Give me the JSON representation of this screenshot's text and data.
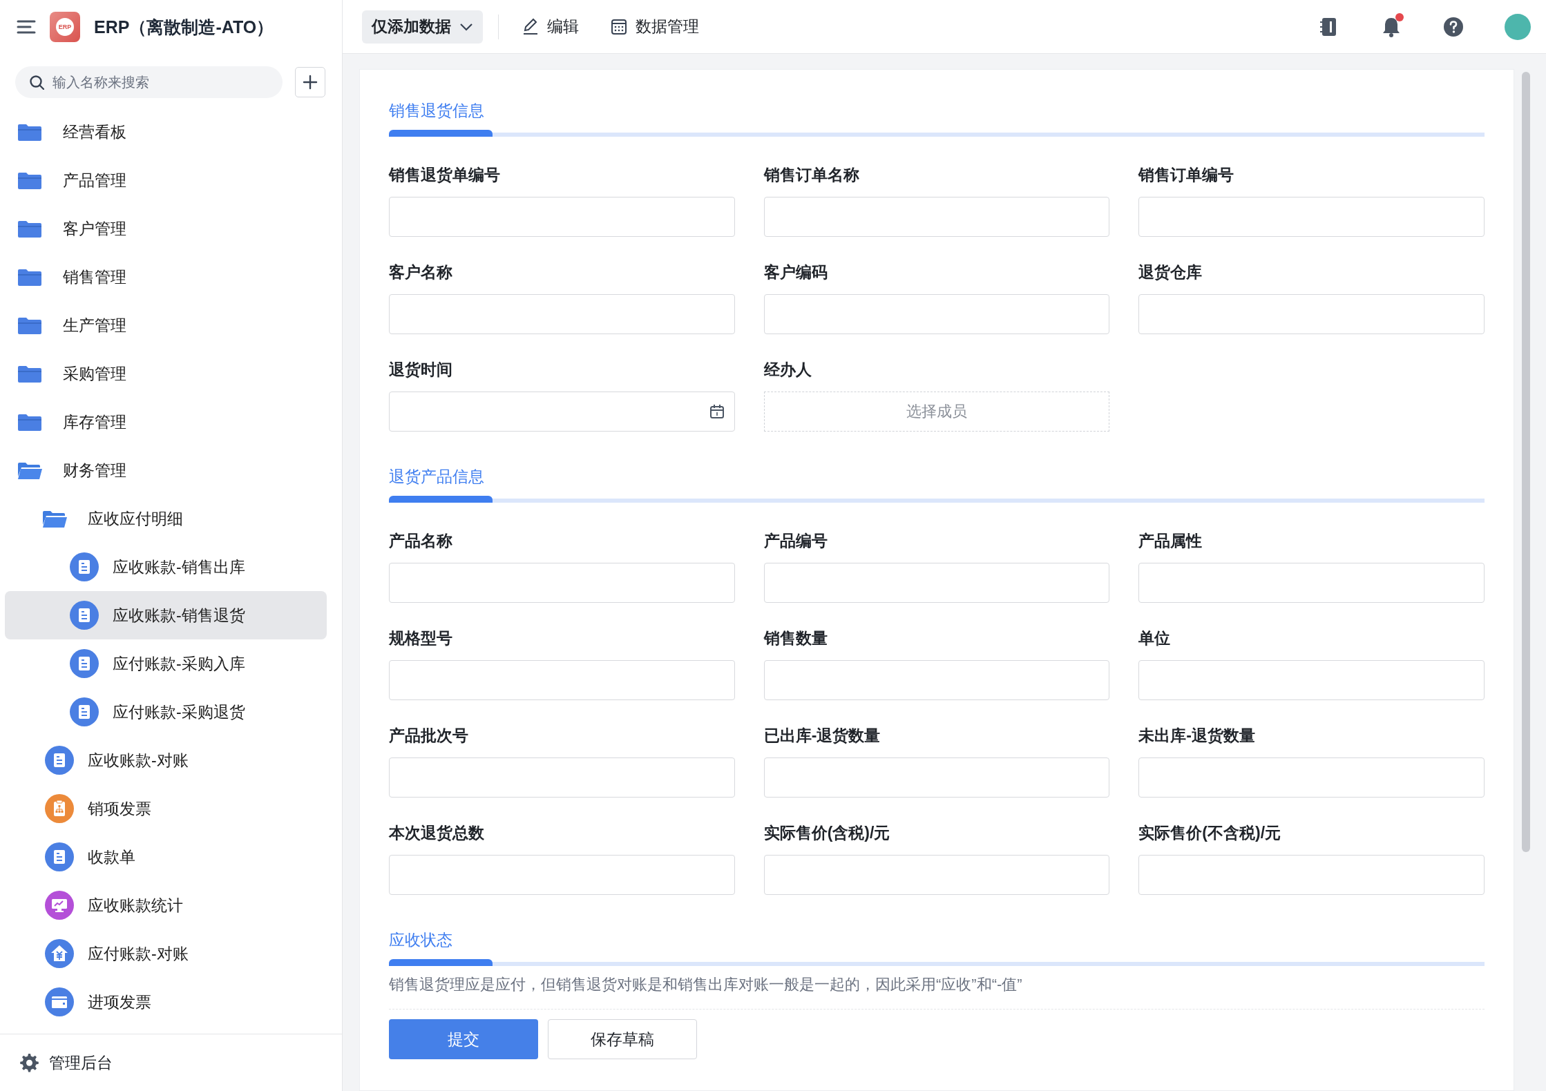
{
  "app": {
    "title": "ERP（离散制造-ATO）",
    "logo_text": "ERP"
  },
  "sidebar": {
    "search": {
      "placeholder": "输入名称来搜索"
    },
    "items": [
      {
        "kind": "folder",
        "label": "经营看板",
        "expanded": false,
        "selected": false
      },
      {
        "kind": "folder",
        "label": "产品管理",
        "expanded": false,
        "selected": false
      },
      {
        "kind": "folder",
        "label": "客户管理",
        "expanded": false,
        "selected": false
      },
      {
        "kind": "folder",
        "label": "销售管理",
        "expanded": false,
        "selected": false
      },
      {
        "kind": "folder",
        "label": "生产管理",
        "expanded": false,
        "selected": false
      },
      {
        "kind": "folder",
        "label": "采购管理",
        "expanded": false,
        "selected": false
      },
      {
        "kind": "folder",
        "label": "库存管理",
        "expanded": false,
        "selected": false
      },
      {
        "kind": "folder",
        "label": "财务管理",
        "expanded": true,
        "selected": false,
        "children": [
          {
            "kind": "folder",
            "label": "应收应付明细",
            "expanded": true,
            "selected": false,
            "children": [
              {
                "kind": "doc",
                "label": "应收账款-销售出库",
                "color": "#4a7fe3",
                "selected": false
              },
              {
                "kind": "doc",
                "label": "应收账款-销售退货",
                "color": "#4a7fe3",
                "selected": true
              },
              {
                "kind": "doc",
                "label": "应付账款-采购入库",
                "color": "#4a7fe3",
                "selected": false
              },
              {
                "kind": "doc",
                "label": "应付账款-采购退货",
                "color": "#4a7fe3",
                "selected": false
              }
            ]
          },
          {
            "kind": "doc",
            "label": "应收账款-对账",
            "color": "#4a7fe3",
            "selected": false
          },
          {
            "kind": "chart-doc",
            "label": "销项发票",
            "color": "#ec8a3a",
            "selected": false
          },
          {
            "kind": "doc",
            "label": "收款单",
            "color": "#4a7fe3",
            "selected": false
          },
          {
            "kind": "monitor",
            "label": "应收账款统计",
            "color": "#b44fd8",
            "selected": false
          },
          {
            "kind": "house",
            "label": "应付账款-对账",
            "color": "#4a7fe3",
            "selected": false
          },
          {
            "kind": "card",
            "label": "进项发票",
            "color": "#4a7fe3",
            "selected": false
          }
        ]
      }
    ],
    "footer": "管理后台"
  },
  "toolbar": {
    "mode": "仅添加数据",
    "actions": [
      {
        "kind": "edit",
        "label": "编辑"
      },
      {
        "kind": "data",
        "label": "数据管理"
      }
    ],
    "notification_dot": true
  },
  "sections": [
    {
      "title": "销售退货信息",
      "fields": [
        {
          "kind": "text",
          "label": "销售退货单编号"
        },
        {
          "kind": "text",
          "label": "销售订单名称"
        },
        {
          "kind": "text",
          "label": "销售订单编号"
        },
        {
          "kind": "text",
          "label": "客户名称"
        },
        {
          "kind": "text",
          "label": "客户编码"
        },
        {
          "kind": "text",
          "label": "退货仓库"
        },
        {
          "kind": "date",
          "label": "退货时间"
        },
        {
          "kind": "member",
          "label": "经办人",
          "placeholder": "选择成员"
        }
      ]
    },
    {
      "title": "退货产品信息",
      "fields": [
        {
          "kind": "text",
          "label": "产品名称"
        },
        {
          "kind": "text",
          "label": "产品编号"
        },
        {
          "kind": "text",
          "label": "产品属性"
        },
        {
          "kind": "text",
          "label": "规格型号"
        },
        {
          "kind": "text",
          "label": "销售数量"
        },
        {
          "kind": "text",
          "label": "单位"
        },
        {
          "kind": "text",
          "label": "产品批次号"
        },
        {
          "kind": "text",
          "label": "已出库-退货数量"
        },
        {
          "kind": "text",
          "label": "未出库-退货数量"
        },
        {
          "kind": "text",
          "label": "本次退货总数"
        },
        {
          "kind": "text",
          "label": "实际售价(含税)/元"
        },
        {
          "kind": "text",
          "label": "实际售价(不含税)/元"
        }
      ]
    },
    {
      "title": "应收状态",
      "note": "销售退货理应是应付，但销售退货对账是和销售出库对账一般是一起的，因此采用“应收”和“-值”"
    }
  ],
  "buttons": [
    {
      "kind": "primary",
      "label": "提交"
    },
    {
      "kind": "secondary",
      "label": "保存草稿"
    }
  ]
}
